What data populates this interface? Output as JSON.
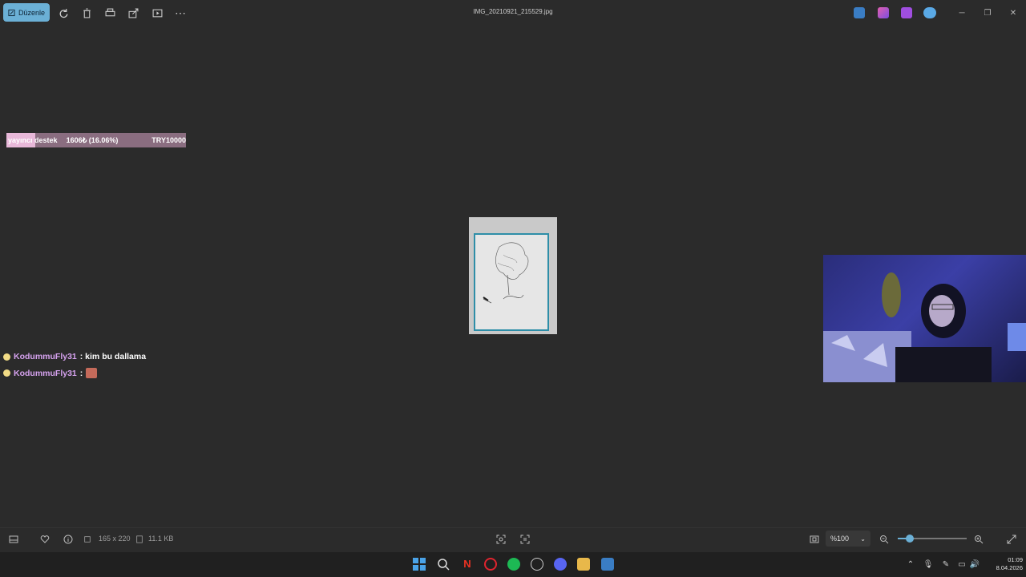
{
  "toolbar": {
    "edit_label": "Düzenle",
    "file_title": "IMG_20210921_215529.jpg"
  },
  "overlay": {
    "goal_label": "yayıncı destek",
    "goal_amount": "1606₺ (16.06%)",
    "goal_target": "TRY10000",
    "goal_progress": 0.1606
  },
  "chat": [
    {
      "user": "KodummuFly31",
      "message": ": kim bu dallama"
    },
    {
      "user": "KodummuFly31",
      "message": ":"
    }
  ],
  "status": {
    "dimensions": "165 x 220",
    "file_size": "11.1 KB",
    "zoom": "%100",
    "zoom_level": 0.15
  },
  "taskbar": {
    "time": "01:09",
    "date": "8.04.2026"
  },
  "colors": {
    "accent": "#6bb0d6",
    "chat_user": "#d6a2ef",
    "goal_fill": "#e8b8d9"
  }
}
